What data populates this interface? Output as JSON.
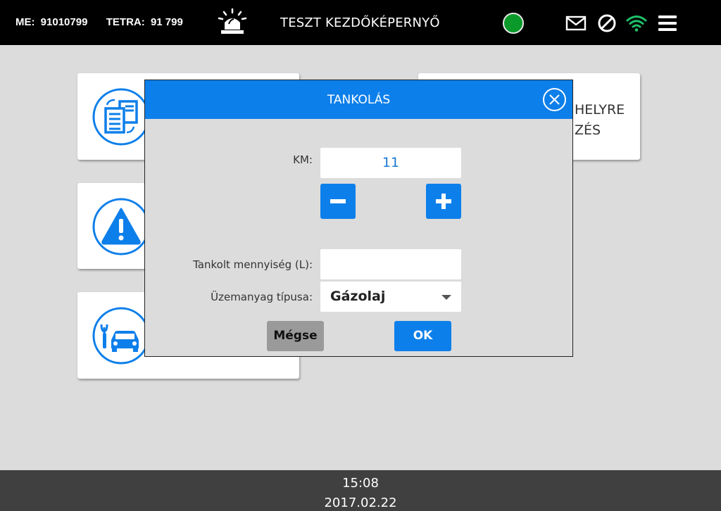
{
  "topbar": {
    "me_label": "ME:",
    "me_value": "91010799",
    "tetra_label": "TETRA:",
    "tetra_value": "91 799",
    "title": "TESZT KEZDŐKÉPERNYŐ",
    "status_color": "#0a9a2a",
    "icons": [
      "siren-icon",
      "mail-icon",
      "blocked-icon",
      "wifi-icon",
      "menu-icon"
    ]
  },
  "tiles": [
    {
      "name": "documents",
      "icon": "documents-icon",
      "text_lines": []
    },
    {
      "name": "site-arrival",
      "icon": "",
      "text_lines": [
        "HELYRE",
        "ZÉS"
      ]
    },
    {
      "name": "warning",
      "icon": "warning-icon",
      "text_lines": []
    },
    {
      "name": "vehicle-service",
      "icon": "car-repair-icon",
      "text_lines": []
    }
  ],
  "dialog": {
    "title": "TANKOLÁS",
    "km_label": "KM:",
    "km_value": "11",
    "amount_label": "Tankolt mennyiség (L):",
    "amount_value": "",
    "fuel_label": "Üzemanyag típusa:",
    "fuel_value": "Gázolaj",
    "cancel_label": "Mégse",
    "ok_label": "OK"
  },
  "footer": {
    "time": "15:08",
    "date": "2017.02.22"
  },
  "colors": {
    "accent": "#0d7fea",
    "background": "#dcdcdc",
    "topbar": "#000000",
    "footer": "#404040",
    "wifi": "#1fc26b"
  }
}
